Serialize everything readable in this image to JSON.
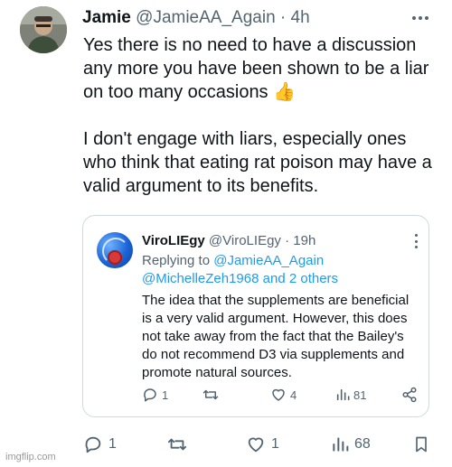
{
  "tweet": {
    "author_name": "Jamie",
    "handle": "@JamieAA_Again",
    "separator": "·",
    "time": "4h",
    "paragraph1": "Yes there is no need to have a discussion any more you have been shown to be a liar on too many occasions",
    "paragraph2": "I don't engage with liars, especially ones who think that eating rat poison may have a valid argument to its benefits.",
    "emoji_icon": "thumbs-up-icon",
    "actions": {
      "reply_count": "1",
      "retweet_count": "",
      "like_count": "1",
      "views_count": "68"
    }
  },
  "quote": {
    "author_name": "ViroLIEgy",
    "handle": "@ViroLIEgy",
    "separator": "·",
    "time": "19h",
    "replying_prefix": "Replying to",
    "replying_user1": "@JamieAA_Again",
    "replying_user2": "@MichelleZeh1968",
    "replying_and": "and",
    "replying_others": "2 others",
    "body": "The idea that the supplements are beneficial is a very valid argument. However, this does not take away from the fact that the Bailey's do not recommend D3 via supplements and promote natural sources.",
    "actions": {
      "reply_count": "1",
      "retweet_count": "",
      "like_count": "4",
      "views_count": "81"
    }
  },
  "watermark": "imgflip.com",
  "colors": {
    "text": "#0f1419",
    "secondary": "#536471",
    "link": "#1d9bf0",
    "border": "#cfd9de"
  }
}
